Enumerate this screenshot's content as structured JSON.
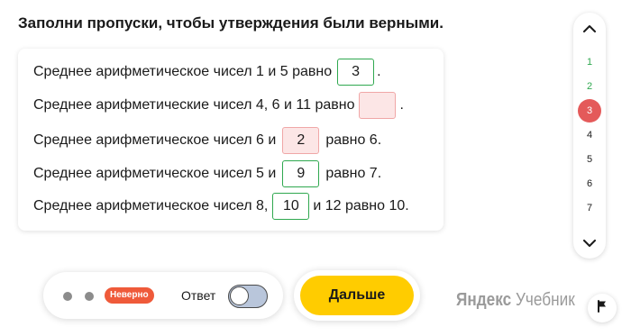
{
  "task": {
    "instruction": "Заполни пропуски, чтобы утверждения были верными."
  },
  "statements": [
    {
      "before": "Среднее арифметическое чисел 1 и 5 равно",
      "answer": "3",
      "status": "correct",
      "after": "."
    },
    {
      "before": "Среднее арифметические чисел 4, 6 и 11 равно",
      "answer": "",
      "status": "incorrect",
      "after": "."
    },
    {
      "before": "Среднее арифметическое чисел 6 и",
      "answer": "2",
      "status": "incorrect",
      "after": "равно 6."
    },
    {
      "before": "Среднее арифметическое чисел 5 и",
      "answer": "9",
      "status": "correct",
      "after": "равно 7."
    },
    {
      "before": "Среднее арифметическое чисел 8,",
      "answer": "10",
      "status": "correct",
      "after": "и 12 равно 10."
    }
  ],
  "task_nav": {
    "items": [
      "1",
      "2",
      "3",
      "4",
      "5",
      "6",
      "7"
    ],
    "current": "3",
    "done": [
      "1",
      "2"
    ],
    "up_icon": "chevron-up-icon",
    "down_icon": "chevron-down-icon"
  },
  "bottom_bar": {
    "result_badge": "Неверно",
    "answer_toggle_label": "Ответ",
    "answer_toggle_on": false
  },
  "next_button": {
    "label": "Дальше"
  },
  "logo": {
    "brand": "Яндекс",
    "product": "Учебник"
  },
  "flag_button": {
    "icon": "flag-icon"
  },
  "colors": {
    "correct": "#2fa84f",
    "incorrect_border": "#f0a7a7",
    "incorrect_fill": "#fce6e6",
    "current_task": "#e45a5a",
    "badge": "#ef5a3a",
    "primary_button": "#ffcc00"
  }
}
